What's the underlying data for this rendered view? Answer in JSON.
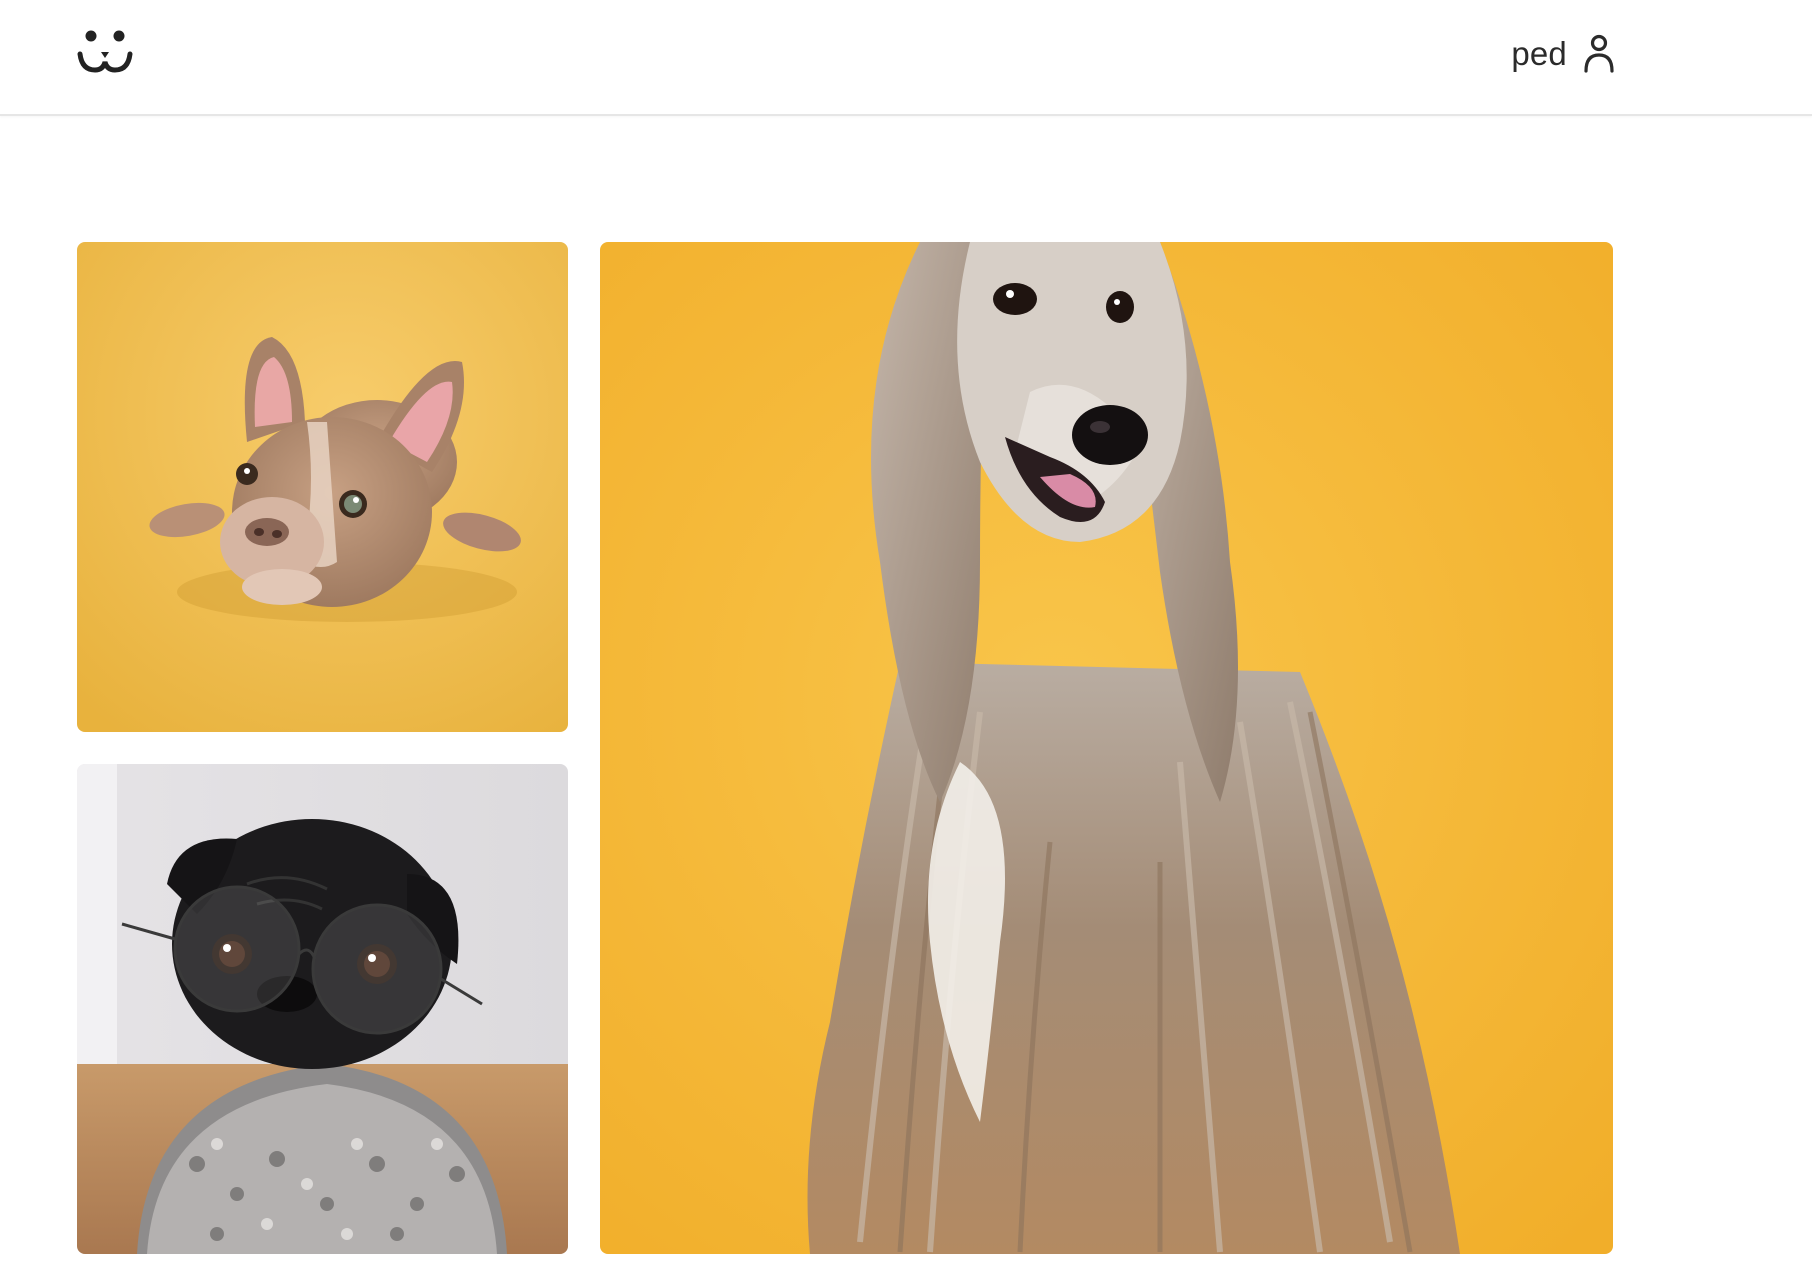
{
  "header": {
    "logo_icon": "smiling-pet-face-icon",
    "username": "ped",
    "user_icon": "user-icon"
  },
  "gallery": {
    "photos": [
      {
        "subject": "french-bulldog-puppy",
        "background": "#F0BE4E"
      },
      {
        "subject": "pug-with-glasses",
        "background": "#E8E6EA"
      },
      {
        "subject": "afghan-hound",
        "background": "#F4B433"
      }
    ]
  },
  "colors": {
    "header_border": "#e6e6e6",
    "text": "#2b2b2b",
    "icon": "#2b2b2b"
  }
}
